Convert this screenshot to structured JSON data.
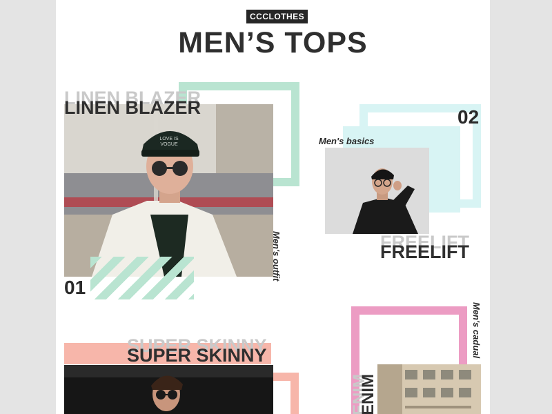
{
  "brand": "CCCLOTHES",
  "page_title": "MEN’S TOPS",
  "products": [
    {
      "name": "LINEN BLAZER",
      "number": "01",
      "tag": "Men's outfit",
      "accent": "#b9e4d1"
    },
    {
      "name": "FREELIFT",
      "number": "02",
      "tag": "Men's basics",
      "accent": "#d8f4f4"
    },
    {
      "name": "SUPER SKINNY",
      "tag": "",
      "accent": "#f7b6aa"
    },
    {
      "name": "ENIM",
      "tag": "Men's cadual",
      "accent": "#ec9cc3"
    }
  ],
  "colors": {
    "background": "#e4e4e4",
    "page": "#ffffff",
    "text": "#2f2f2f",
    "ghost": "#c9c9c9"
  }
}
